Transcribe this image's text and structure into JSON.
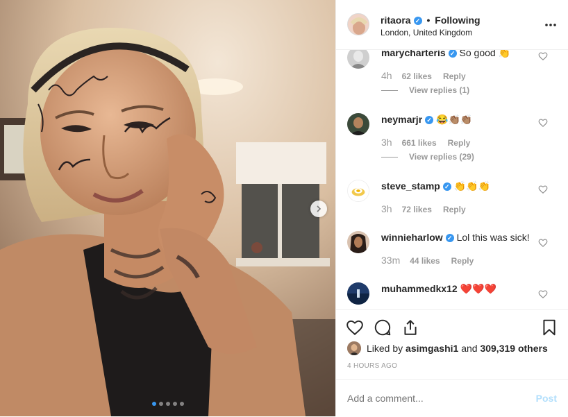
{
  "post": {
    "carousel_dots": 5,
    "active_dot": 0
  },
  "header": {
    "username": "ritaora",
    "separator": "•",
    "follow_label": "Following",
    "location": "London, United Kingdom",
    "more_label": "..."
  },
  "comments": [
    {
      "user": "marycharteris",
      "verified": true,
      "text": "So good 👏",
      "time": "4h",
      "likes": "62 likes",
      "reply": "Reply",
      "view_replies": "View replies (1)"
    },
    {
      "user": "neymarjr",
      "verified": true,
      "text": "😂👏🏽👏🏽",
      "time": "3h",
      "likes": "661 likes",
      "reply": "Reply",
      "view_replies": "View replies (29)"
    },
    {
      "user": "steve_stamp",
      "verified": true,
      "text": "👏👏👏",
      "time": "3h",
      "likes": "72 likes",
      "reply": "Reply"
    },
    {
      "user": "winnieharlow",
      "verified": true,
      "text": "Lol this was sick!",
      "time": "33m",
      "likes": "44 likes",
      "reply": "Reply"
    },
    {
      "user": "muhammedkx12",
      "verified": false,
      "text": "❤️❤️❤️"
    }
  ],
  "likes": {
    "prefix": "Liked by",
    "user": "asimgashi1",
    "and": "and",
    "count": "309,319 others"
  },
  "time_ago": "4 HOURS AGO",
  "add_comment": {
    "placeholder": "Add a comment...",
    "post_label": "Post"
  },
  "colors": {
    "accent": "#3897f0",
    "post_disabled": "#b2dffc",
    "heart_red": "#e0245e"
  }
}
